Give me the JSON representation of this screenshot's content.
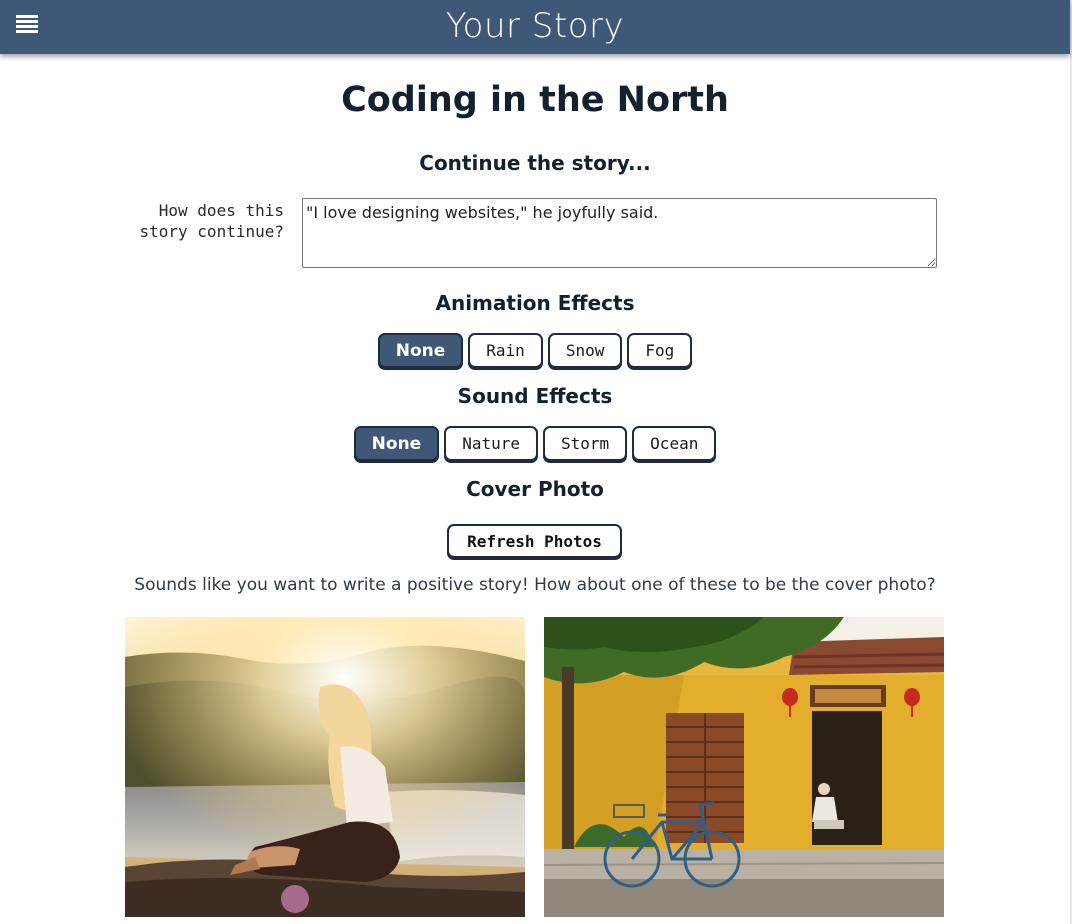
{
  "header": {
    "title": "Your Story",
    "menu_icon": "hamburger-menu-icon",
    "background": "#3f5877"
  },
  "story": {
    "title": "Coding in the North",
    "continue_heading": "Continue the story...",
    "prompt_label": "How does this story continue?",
    "input_value": "\"I love designing websites,\" he joyfully said."
  },
  "animation": {
    "heading": "Animation Effects",
    "options": [
      "None",
      "Rain",
      "Snow",
      "Fog"
    ],
    "selected": "None"
  },
  "sound": {
    "heading": "Sound Effects",
    "options": [
      "None",
      "Nature",
      "Storm",
      "Ocean"
    ],
    "selected": "None"
  },
  "cover": {
    "heading": "Cover Photo",
    "refresh_label": "Refresh Photos",
    "suggestion": "Sounds like you want to write a positive story! How about one of these to be the cover photo?"
  },
  "colors": {
    "accent": "#3f5877",
    "selected_button": "#3f5877"
  }
}
